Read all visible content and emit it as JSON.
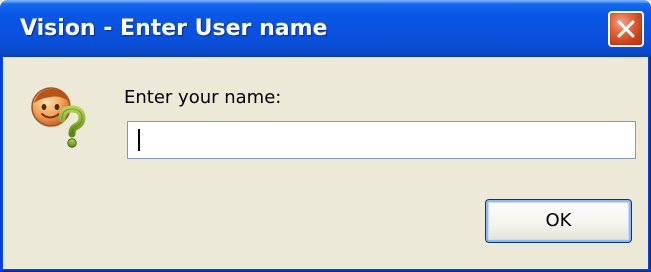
{
  "window": {
    "title": "Vision - Enter User name",
    "close_icon": "close-icon"
  },
  "dialog": {
    "icon": "user-question-icon",
    "prompt": "Enter your name:",
    "input_value": "",
    "ok_label": "OK"
  },
  "colors": {
    "titlebar": "#0a52df",
    "close_button": "#e2673e",
    "client_background": "#ece9d8",
    "input_border": "#7f9db9",
    "button_border": "#003c74"
  }
}
